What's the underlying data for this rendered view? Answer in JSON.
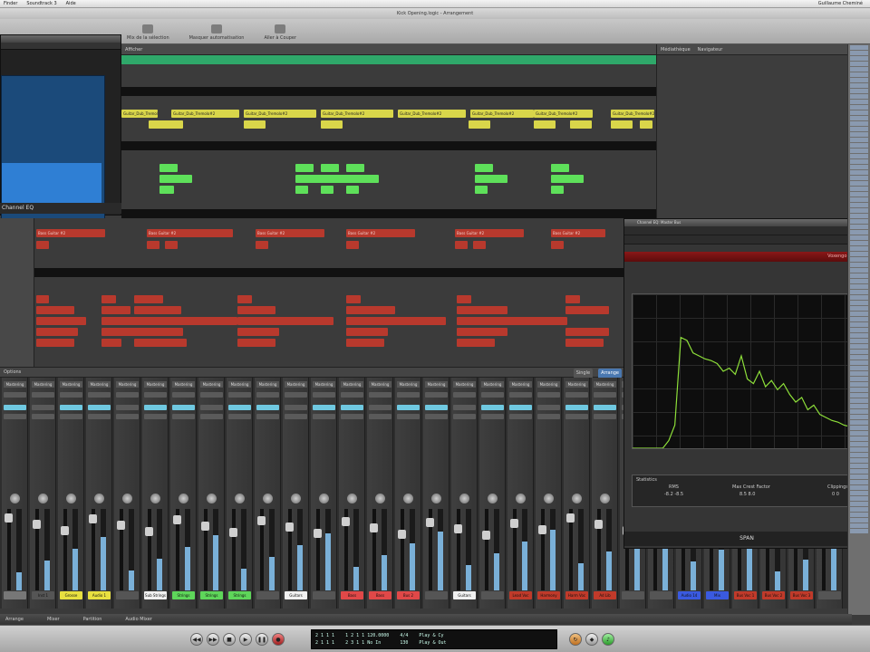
{
  "menubar": {
    "app": "Finder",
    "items": [
      "Soundtrack 3",
      "Aide"
    ],
    "right": "Guillaume Cheminé"
  },
  "window": {
    "title": "Kick Opening.logic - Arrangement"
  },
  "toolbar": {
    "items": [
      "Mix de la sélection",
      "Masquer automatisation",
      "Aller à Couper"
    ]
  },
  "arrange": {
    "header_label": "Afficher",
    "regions_y": [
      "Guitar_Dub_Tremolo#2",
      "Guitar_Dub_Tremolo#2",
      "Guitar_Dub_Tremolo#2",
      "Guitar_Dub_Tremolo#2",
      "Guitar_Dub_Tremolo#2",
      "Guitar_Dub_Tremolo#2",
      "Guitar_Dub_Tremolo#2",
      "Guitar_Dub_Tremolo#2"
    ],
    "regions_r": [
      "Bass Guitar #2",
      "Bass Guitar #2",
      "Bass Guitar #2",
      "Bass Guitar #2",
      "Bass Guitar #2",
      "Bass Guitar #2",
      "Bass Guitar #2"
    ]
  },
  "inspector": {
    "label": "Channel EQ"
  },
  "browser": {
    "tabs": [
      "Médiathèque",
      "Navigateur"
    ]
  },
  "mixer": {
    "bar_label": "Options",
    "tabs": [
      "Single",
      "Arrange"
    ],
    "strips": [
      {
        "name": "Mastering",
        "label": "",
        "color": "#777"
      },
      {
        "name": "Mastering",
        "label": "Inst 1",
        "color": "#555"
      },
      {
        "name": "Mastering",
        "label": "Grosse",
        "color": "#e8e040"
      },
      {
        "name": "Mastering",
        "label": "Audio 1",
        "color": "#e8e040"
      },
      {
        "name": "Mastering",
        "label": "",
        "color": "#555"
      },
      {
        "name": "Mastering",
        "label": "Sub Strings",
        "color": "#f0f0f0"
      },
      {
        "name": "Mastering",
        "label": "Strings",
        "color": "#5ed65a"
      },
      {
        "name": "Mastering",
        "label": "Strings",
        "color": "#5ed65a"
      },
      {
        "name": "Mastering",
        "label": "Strings",
        "color": "#5ed65a"
      },
      {
        "name": "Mastering",
        "label": "",
        "color": "#555"
      },
      {
        "name": "Mastering",
        "label": "Guitars",
        "color": "#f0f0f0"
      },
      {
        "name": "Mastering",
        "label": "",
        "color": "#555"
      },
      {
        "name": "Mastering",
        "label": "Bass",
        "color": "#e04848"
      },
      {
        "name": "Mastering",
        "label": "Bass",
        "color": "#e04848"
      },
      {
        "name": "Mastering",
        "label": "Bus 2",
        "color": "#e04848"
      },
      {
        "name": "Mastering",
        "label": "",
        "color": "#555"
      },
      {
        "name": "Mastering",
        "label": "Guitars",
        "color": "#f0f0f0"
      },
      {
        "name": "Mastering",
        "label": "",
        "color": "#555"
      },
      {
        "name": "Mastering",
        "label": "Lead Voc",
        "color": "#c03a2a"
      },
      {
        "name": "Mastering",
        "label": "Harmony",
        "color": "#c03a2a"
      },
      {
        "name": "Mastering",
        "label": "Harm Voc",
        "color": "#c03a2a"
      },
      {
        "name": "Mastering",
        "label": "Ad Lib",
        "color": "#c03a2a"
      },
      {
        "name": "Mastering",
        "label": "",
        "color": "#555"
      },
      {
        "name": "Mastering",
        "label": "",
        "color": "#555"
      },
      {
        "name": "Mastering",
        "label": "Audio 14",
        "color": "#3a5ae0"
      },
      {
        "name": "Mastering",
        "label": "Mix",
        "color": "#3a5ae0"
      },
      {
        "name": "Mastering",
        "label": "Bus Voc 1",
        "color": "#c03a2a"
      },
      {
        "name": "Mastering",
        "label": "Bus Voc 2",
        "color": "#c03a2a"
      },
      {
        "name": "Mastering",
        "label": "Bus Voc 3",
        "color": "#c03a2a"
      },
      {
        "name": "Mastering",
        "label": "",
        "color": "#555"
      }
    ]
  },
  "bottombar": {
    "items": [
      "Arrange",
      "Mixer",
      "Partition",
      "Audio Mixer"
    ]
  },
  "transport": {
    "lcd_line1": "2 1 1 1    1 2 1 1 120.0000    4/4    Play & Cy",
    "lcd_line2": "2 1 1 1    2 3 1 1 No In       130    Play & Out"
  },
  "spectrum": {
    "window_title": "Channel EQ: Master Bus",
    "plugin_name": "Voxengo SPAN",
    "statistics_label": "Statistics",
    "rms_label": "RMS",
    "rms_value": "-8.2  -8.5",
    "maxcrest_label": "Max Crest Factor",
    "maxcrest_value": "8.5  8.0",
    "clippings_label": "Clippings",
    "clippings_value": "0  0",
    "footer": "SPAN",
    "data": [
      0,
      0,
      0,
      0,
      0,
      0,
      0.05,
      0.15,
      0.72,
      0.7,
      0.62,
      0.6,
      0.58,
      0.57,
      0.55,
      0.5,
      0.52,
      0.48,
      0.6,
      0.45,
      0.42,
      0.5,
      0.4,
      0.44,
      0.38,
      0.42,
      0.35,
      0.3,
      0.33,
      0.25,
      0.28,
      0.22,
      0.2,
      0.18,
      0.17,
      0.15,
      0.14,
      0.12,
      0.11,
      0.1
    ]
  }
}
